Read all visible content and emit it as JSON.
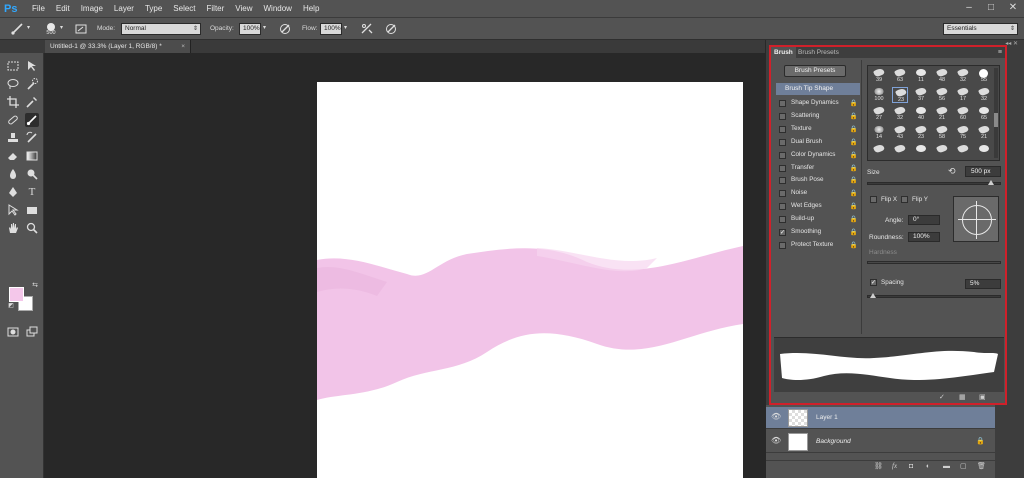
{
  "app": {
    "logo": "Ps"
  },
  "menu": [
    "File",
    "Edit",
    "Image",
    "Layer",
    "Type",
    "Select",
    "Filter",
    "View",
    "Window",
    "Help"
  ],
  "options_bar": {
    "brush_size": "500",
    "mode_label": "Mode:",
    "mode_value": "Normal",
    "opacity_label": "Opacity:",
    "opacity_value": "100%",
    "flow_label": "Flow:",
    "flow_value": "100%",
    "workspace": "Essentials"
  },
  "document_tab": {
    "title": "Untitled-1 @ 33.3% (Layer 1, RGB/8) *",
    "close": "×"
  },
  "colors": {
    "foreground": "#f4c7ea",
    "background": "#ffffff",
    "stroke": "#f2c4e8",
    "accent": "#d0202a"
  },
  "brush_panel": {
    "tabs": [
      "Brush",
      "Brush Presets"
    ],
    "presets_button": "Brush Presets",
    "tip_shape": "Brush Tip Shape",
    "options": [
      {
        "label": "Shape Dynamics",
        "checked": false
      },
      {
        "label": "Scattering",
        "checked": false
      },
      {
        "label": "Texture",
        "checked": false
      },
      {
        "label": "Dual Brush",
        "checked": false
      },
      {
        "label": "Color Dynamics",
        "checked": false
      },
      {
        "label": "Transfer",
        "checked": false
      },
      {
        "label": "Brush Pose",
        "checked": false
      },
      {
        "label": "Noise",
        "checked": false
      },
      {
        "label": "Wet Edges",
        "checked": false
      },
      {
        "label": "Build-up",
        "checked": false
      },
      {
        "label": "Smoothing",
        "checked": true
      },
      {
        "label": "Protect Texture",
        "checked": false
      }
    ],
    "tips": [
      [
        "39",
        "63",
        "11",
        "48",
        "32",
        "55"
      ],
      [
        "100",
        "23",
        "37",
        "56",
        "17",
        "32"
      ],
      [
        "27",
        "32",
        "40",
        "21",
        "60",
        "65"
      ],
      [
        "14",
        "43",
        "23",
        "58",
        "75",
        "21"
      ],
      [
        "",
        "",
        "",
        "",
        "",
        ""
      ]
    ],
    "size_label": "Size",
    "size_value": "500 px",
    "flip_x": "Flip X",
    "flip_y": "Flip Y",
    "angle_label": "Angle:",
    "angle_value": "0°",
    "roundness_label": "Roundness:",
    "roundness_value": "100%",
    "hardness_label": "Hardness",
    "spacing_label": "Spacing",
    "spacing_value": "5%"
  },
  "layers": [
    {
      "name": "Layer 1",
      "selected": true
    },
    {
      "name": "Background",
      "selected": false
    }
  ]
}
